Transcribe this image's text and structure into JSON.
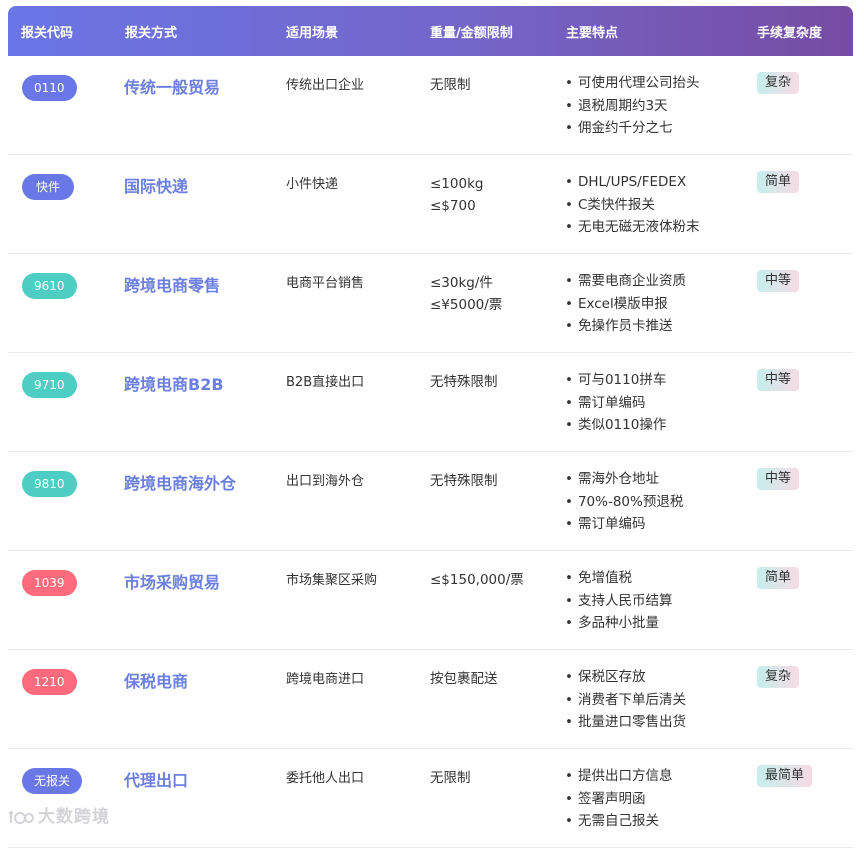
{
  "headers": {
    "code": "报关代码",
    "method": "报关方式",
    "scene": "适用场景",
    "limit": "重量/金额限制",
    "features": "主要特点",
    "complexity": "手续复杂度"
  },
  "colors": {
    "header_gradient_start": "#6a75e6",
    "header_gradient_end": "#764ba2",
    "badge_blue": "#6a77e6",
    "badge_teal": "#4ecdc4",
    "badge_red": "#ff6b7d",
    "name_color": "#6b7fe0"
  },
  "rows": [
    {
      "code": "0110",
      "badge_color": "#6a77e6",
      "method": "传统一般贸易",
      "scene": "传统出口企业",
      "limit": [
        "无限制"
      ],
      "features": [
        "可使用代理公司抬头",
        "退税周期约3天",
        "佣金约千分之七"
      ],
      "complexity": "复杂"
    },
    {
      "code": "快件",
      "badge_color": "#6a77e6",
      "method": "国际快递",
      "scene": "小件快递",
      "limit": [
        "≤100kg",
        "≤$700"
      ],
      "features": [
        "DHL/UPS/FEDEX",
        "C类快件报关",
        "无电无磁无液体粉末"
      ],
      "complexity": "简单"
    },
    {
      "code": "9610",
      "badge_color": "#4ecdc4",
      "method": "跨境电商零售",
      "scene": "电商平台销售",
      "limit": [
        "≤30kg/件",
        "≤¥5000/票"
      ],
      "features": [
        "需要电商企业资质",
        "Excel模版申报",
        "免操作员卡推送"
      ],
      "complexity": "中等"
    },
    {
      "code": "9710",
      "badge_color": "#4ecdc4",
      "method": "跨境电商B2B",
      "scene": "B2B直接出口",
      "limit": [
        "无特殊限制"
      ],
      "features": [
        "可与0110拼车",
        "需订单编码",
        "类似0110操作"
      ],
      "complexity": "中等"
    },
    {
      "code": "9810",
      "badge_color": "#4ecdc4",
      "method": "跨境电商海外仓",
      "scene": "出口到海外仓",
      "limit": [
        "无特殊限制"
      ],
      "features": [
        "需海外仓地址",
        "70%-80%预退税",
        "需订单编码"
      ],
      "complexity": "中等"
    },
    {
      "code": "1039",
      "badge_color": "#ff6b7d",
      "method": "市场采购贸易",
      "scene": "市场集聚区采购",
      "limit": [
        "≤$150,000/票"
      ],
      "features": [
        "免增值税",
        "支持人民币结算",
        "多品种小批量"
      ],
      "complexity": "简单"
    },
    {
      "code": "1210",
      "badge_color": "#ff6b7d",
      "method": "保税电商",
      "scene": "跨境电商进口",
      "limit": [
        "按包裹配送"
      ],
      "features": [
        "保税区存放",
        "消费者下单后清关",
        "批量进口零售出货"
      ],
      "complexity": "复杂"
    },
    {
      "code": "无报关",
      "badge_color": "#6a77e6",
      "method": "代理出口",
      "scene": "委托他人出口",
      "limit": [
        "无限制"
      ],
      "features": [
        "提供出口方信息",
        "签署声明函",
        "无需自己报关"
      ],
      "complexity": "最简单"
    }
  ],
  "watermark": {
    "text": "大数跨境"
  }
}
